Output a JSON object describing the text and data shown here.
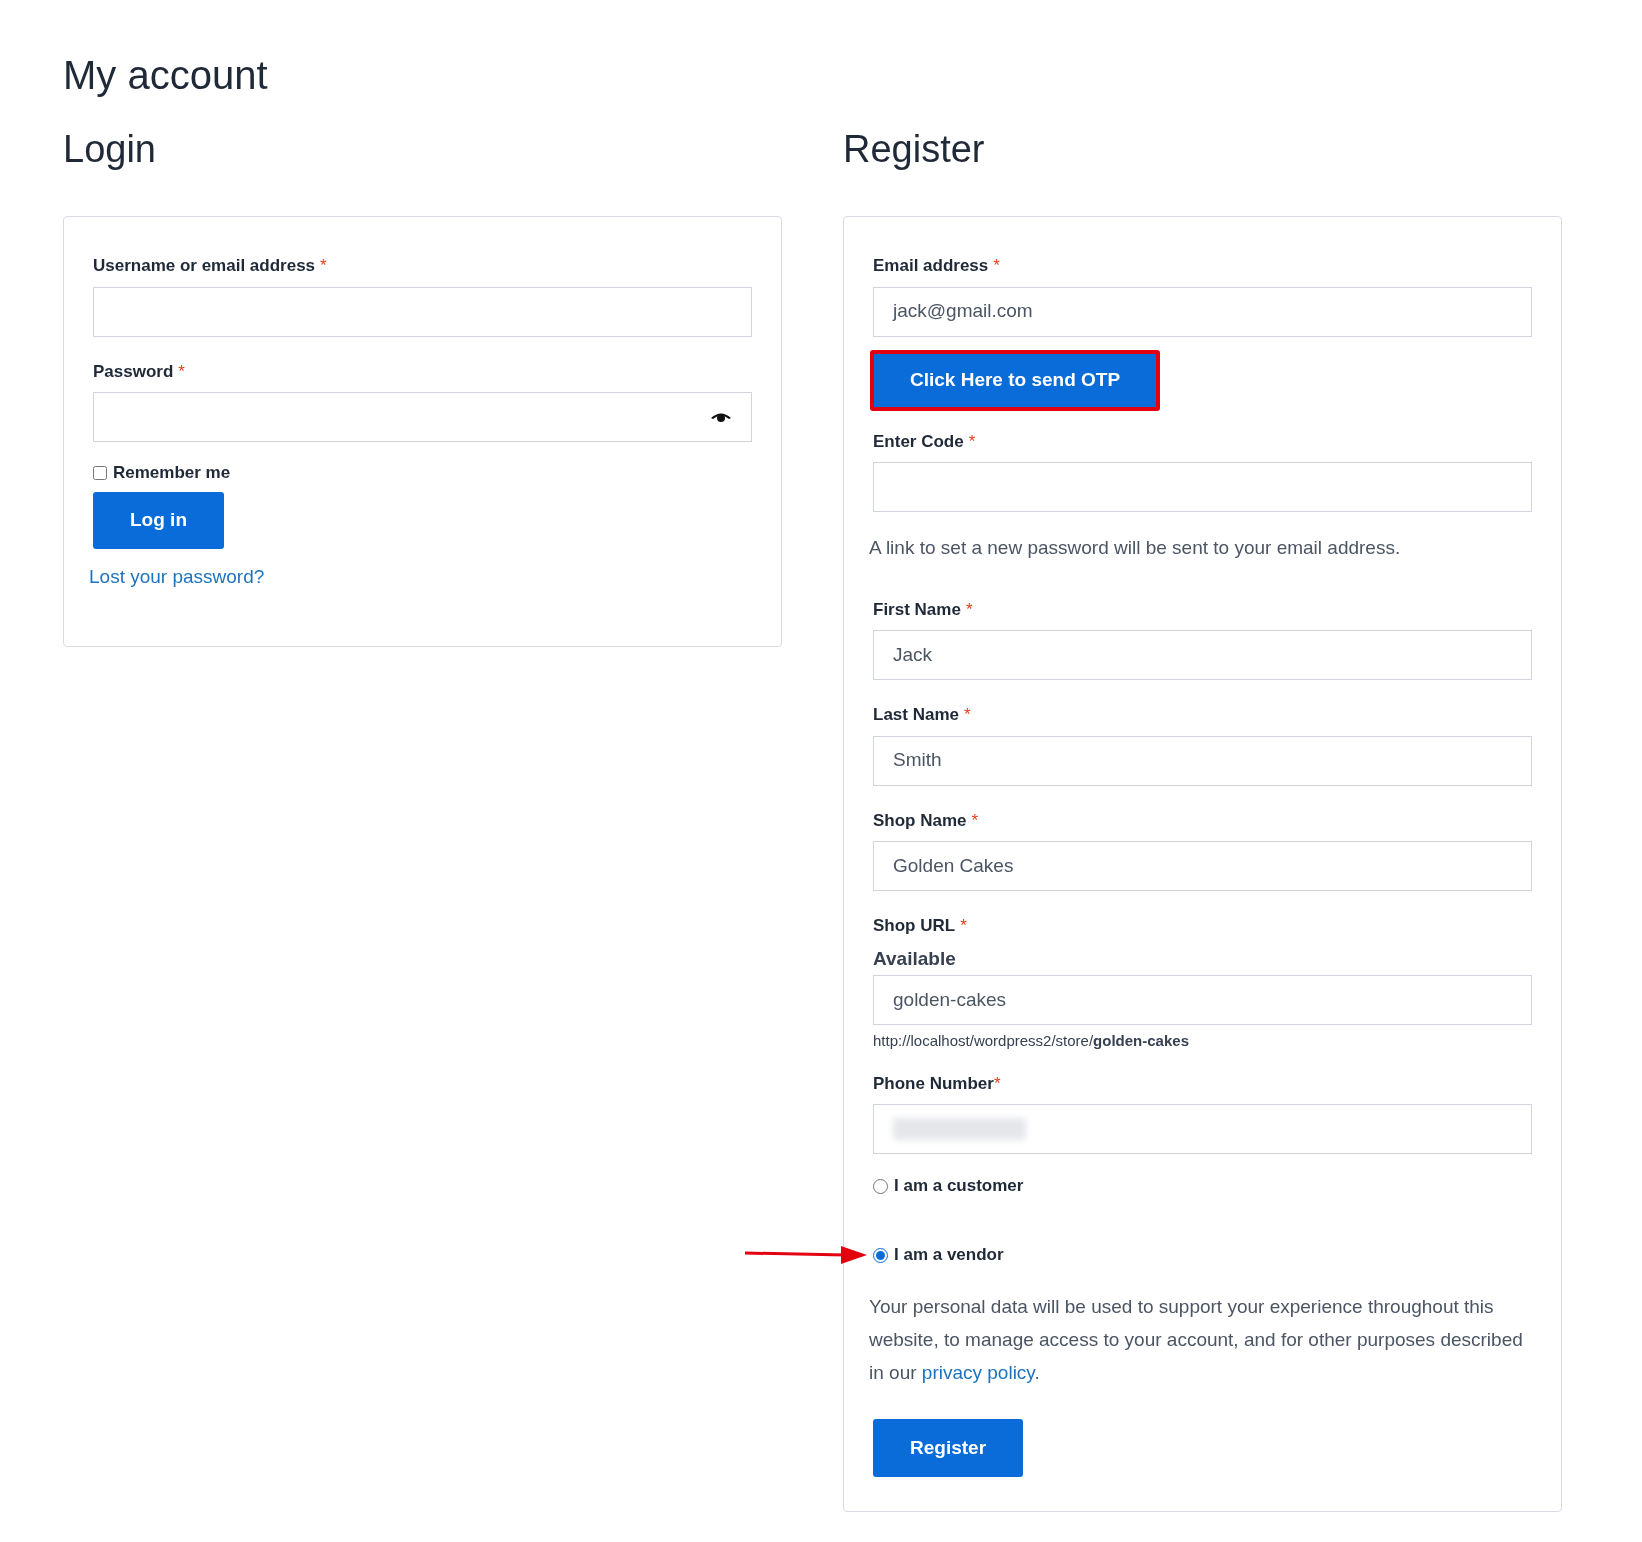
{
  "page_title": "My account",
  "login": {
    "heading": "Login",
    "fields": [
      {
        "label": "Username or email address",
        "required_mark": "*",
        "kind": "text"
      },
      {
        "label": "Password",
        "required_mark": "*",
        "kind": "password"
      }
    ],
    "remember": {
      "label": "Remember me",
      "checked": false
    },
    "button": "Log in",
    "lost_password": "Lost your password?"
  },
  "register": {
    "heading": "Register",
    "items": [
      {
        "kind": "field",
        "label": "Email address",
        "required_mark": "*",
        "value": "jack@gmail.com"
      },
      {
        "kind": "button",
        "label": "Click Here to send OTP",
        "highlighted": true
      },
      {
        "kind": "field",
        "label": "Enter Code",
        "required_mark": "*"
      },
      {
        "kind": "note",
        "text": "A link to set a new password will be sent to your email address."
      },
      {
        "kind": "field",
        "label": "First Name",
        "required_mark": "*",
        "value": "Jack"
      },
      {
        "kind": "field",
        "label": "Last Name",
        "required_mark": "*",
        "value": "Smith"
      },
      {
        "kind": "field",
        "label": "Shop Name",
        "required_mark": "*",
        "value": "Golden Cakes"
      },
      {
        "kind": "url_field",
        "label": "Shop URL",
        "required_mark": "*",
        "status": "Available",
        "value": "golden-cakes",
        "hint": "http://localhost/wordpress2/store/**golden-cakes**"
      },
      {
        "kind": "blurred_field",
        "label": "Phone Number",
        "required_mark": "*"
      },
      {
        "kind": "radio",
        "label": "I am a customer",
        "selected": false,
        "arrow": false
      },
      {
        "kind": "radio",
        "label": "I am a vendor",
        "selected": true,
        "arrow": true
      },
      {
        "kind": "privacy",
        "text": "Your personal data will be used to support your experience throughout this website, to manage access to your account, and for other purposes described in our ",
        "link": "privacy policy",
        "after": "."
      },
      {
        "kind": "submit",
        "label": "Register"
      }
    ]
  }
}
